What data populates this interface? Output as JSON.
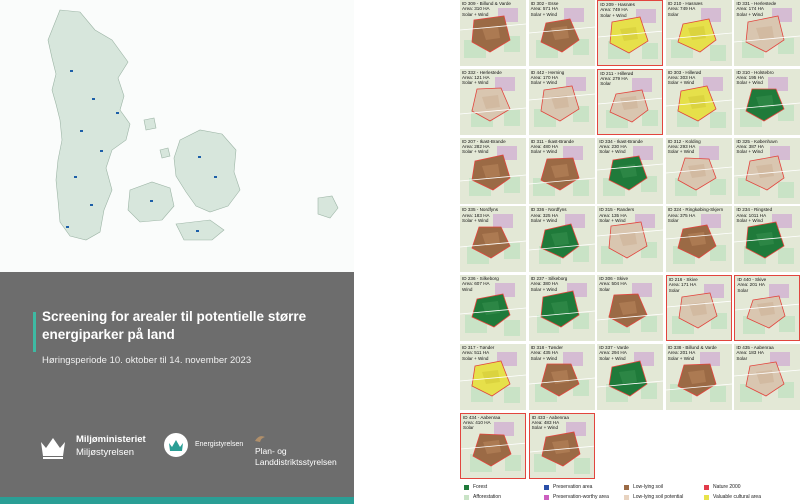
{
  "cover": {
    "title": "Screening for arealer til potentielle større energiparker på land",
    "subtitle": "Høringsperiode 10. oktober til 14. november 2023",
    "logos": [
      {
        "icon": "crown-icon",
        "line1": "Miljøministeriet",
        "line2": "Miljøstyrelsen"
      },
      {
        "icon": "crown-circle-icon",
        "line1": "Energistyrelsen"
      },
      {
        "icon": "bird-icon",
        "line1": "Plan- og",
        "line2": "Landdistriktsstyrelsen"
      }
    ]
  },
  "tiles": [
    {
      "id": "ID 309 - Billund & Varde",
      "area": "Area: 310 HA",
      "type": "Solar + Wind",
      "scheme": "brown"
    },
    {
      "id": "ID 302 - Esse",
      "area": "Area: 571 HA",
      "type": "Solar + Wind",
      "scheme": "brown"
    },
    {
      "id": "ID 209 - Hasnæs",
      "area": "Area: 749 HA",
      "type": "Solar + Wind",
      "scheme": "yellow",
      "selected": true
    },
    {
      "id": "ID 210 - Hasnæs",
      "area": "Area: 749 HA",
      "type": "Solar",
      "scheme": "yellow"
    },
    {
      "id": "ID 331 - Herlestede",
      "area": "Area: 174 HA",
      "type": "Solar + Wind",
      "scheme": "light"
    },
    {
      "id": "ID 332 - Herlestede",
      "area": "Area: 121 HA",
      "type": "Solar + Wind",
      "scheme": "light"
    },
    {
      "id": "ID 442 - Herning",
      "area": "Area: 170 HA",
      "type": "Solar + Wind",
      "scheme": "light"
    },
    {
      "id": "ID 211 - Hillerød",
      "area": "Area: 279 HA",
      "type": "Solar",
      "scheme": "light",
      "selected": true
    },
    {
      "id": "ID 303 - Hillerød",
      "area": "Area: 303 HA",
      "type": "Solar + Wind",
      "scheme": "yellow"
    },
    {
      "id": "ID 310 - Holstebro",
      "area": "Area: 195 HA",
      "type": "Solar + Wind",
      "scheme": "green"
    },
    {
      "id": "ID 207 - Ikast-Brande",
      "area": "Area: 282 HA",
      "type": "Solar + Wind",
      "scheme": "brown"
    },
    {
      "id": "ID 311 - Ikast-Brande",
      "area": "Area: 480 HA",
      "type": "Solar + Wind",
      "scheme": "brown"
    },
    {
      "id": "ID 334 - Ikast-Brande",
      "area": "Area: 230 HA",
      "type": "Solar + Wind",
      "scheme": "green"
    },
    {
      "id": "ID 312 - Kolding",
      "area": "Area: 293 HA",
      "type": "Solar + Wind",
      "scheme": "light"
    },
    {
      "id": "ID 325 - København",
      "area": "Area: 387 HA",
      "type": "Solar + Wind",
      "scheme": "light"
    },
    {
      "id": "ID 335 - Nordfyns",
      "area": "Area: 183 HA",
      "type": "Solar + Wind",
      "scheme": "brown"
    },
    {
      "id": "ID 336 - Nordfyns",
      "area": "Area: 325 HA",
      "type": "Solar + Wind",
      "scheme": "green"
    },
    {
      "id": "ID 315 - Randers",
      "area": "Area: 135 HA",
      "type": "Solar + Wind",
      "scheme": "light"
    },
    {
      "id": "ID 324 - Ringkøbing-Skjern",
      "area": "Area: 375 HA",
      "type": "Solar",
      "scheme": "brown"
    },
    {
      "id": "ID 234 - Ringsted",
      "area": "Area: 1011 HA",
      "type": "Solar + Wind",
      "scheme": "green"
    },
    {
      "id": "ID 236 - Silkeborg",
      "area": "Area: 607 HA",
      "type": "Wind",
      "scheme": "green"
    },
    {
      "id": "ID 237 - Silkeborg",
      "area": "Area: 380 HA",
      "type": "Solar + Wind",
      "scheme": "green"
    },
    {
      "id": "ID 306 - Skive",
      "area": "Area: 504 HA",
      "type": "Solar",
      "scheme": "brown"
    },
    {
      "id": "ID 216 - Skive",
      "area": "Area: 171 HA",
      "type": "Solar",
      "scheme": "light",
      "selected": true
    },
    {
      "id": "ID 440 - Skive",
      "area": "Area: 201 HA",
      "type": "Solar",
      "scheme": "light",
      "selected": true
    },
    {
      "id": "ID 317 - Tønder",
      "area": "Area: 511 HA",
      "type": "Solar + Wind",
      "scheme": "yellow"
    },
    {
      "id": "ID 318 - Tønder",
      "area": "Area: 435 HA",
      "type": "Solar + Wind",
      "scheme": "brown"
    },
    {
      "id": "ID 337 - Varde",
      "area": "Area: 294 HA",
      "type": "Solar + Wind",
      "scheme": "green"
    },
    {
      "id": "ID 338 - Billund & Varde",
      "area": "Area: 201 HA",
      "type": "Solar + Wind",
      "scheme": "brown"
    },
    {
      "id": "ID 435 - Aabenraa",
      "area": "Area: 183 HA",
      "type": "Solar",
      "scheme": "light"
    },
    {
      "id": "ID 434 - Aabenraa",
      "area": "Area: 410 HA",
      "type": "Solar",
      "scheme": "brown",
      "selected": true
    },
    {
      "id": "ID 433 - Aabenraa",
      "area": "Area: 483 HA",
      "type": "Solar + Wind",
      "scheme": "brown",
      "selected": true
    }
  ],
  "legend": [
    {
      "label": "Forest",
      "color": "#1f7a3a"
    },
    {
      "label": "Preservation area",
      "color": "#2a4fa8"
    },
    {
      "label": "Low-lying soil",
      "color": "#9b6a45"
    },
    {
      "label": "Nature 2000",
      "color": "#e23b4b"
    },
    {
      "label": "Afforestation",
      "color": "#c9e3c6"
    },
    {
      "label": "Preservation-worthy area",
      "color": "#cc5fc0"
    },
    {
      "label": "Low-lying soil potential",
      "color": "#e8d3c0"
    },
    {
      "label": "Valuable cultural area",
      "color": "#e8e34a"
    }
  ]
}
